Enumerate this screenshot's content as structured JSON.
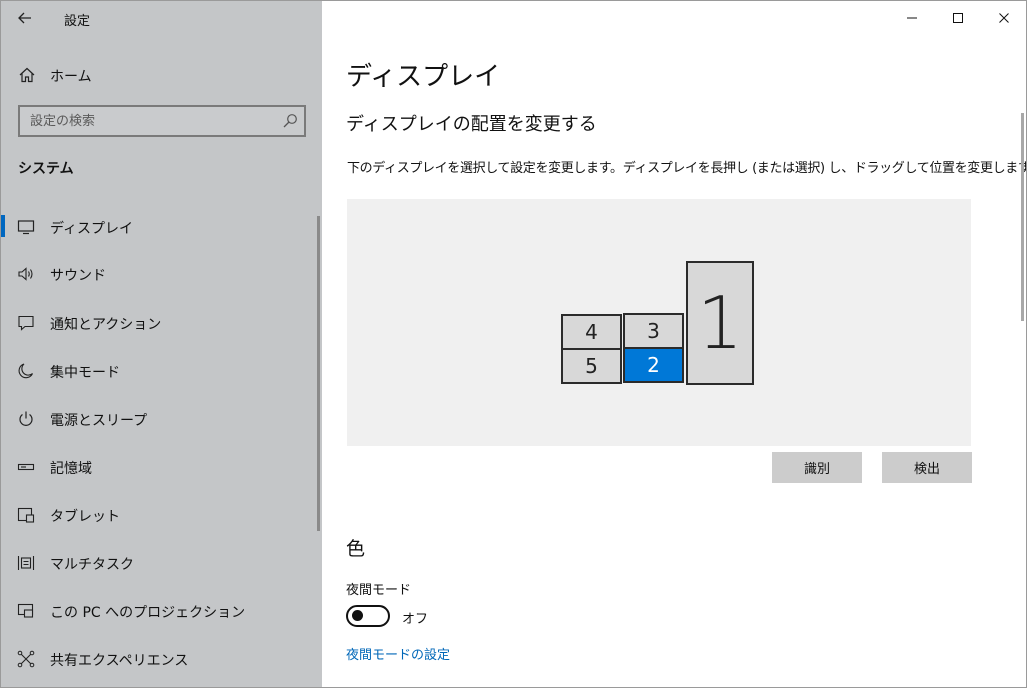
{
  "window": {
    "title": "設定",
    "buttons": {
      "minimize": "minimize",
      "maximize": "maximize",
      "close": "close"
    }
  },
  "sidebar": {
    "home_label": "ホーム",
    "search_placeholder": "設定の検索",
    "section_title": "システム",
    "items": [
      {
        "label": "ディスプレイ",
        "icon": "monitor-icon",
        "active": true
      },
      {
        "label": "サウンド",
        "icon": "speaker-icon",
        "active": false
      },
      {
        "label": "通知とアクション",
        "icon": "notification-icon",
        "active": false
      },
      {
        "label": "集中モード",
        "icon": "moon-icon",
        "active": false
      },
      {
        "label": "電源とスリープ",
        "icon": "power-icon",
        "active": false
      },
      {
        "label": "記憶域",
        "icon": "storage-icon",
        "active": false
      },
      {
        "label": "タブレット",
        "icon": "tablet-icon",
        "active": false
      },
      {
        "label": "マルチタスク",
        "icon": "multitask-icon",
        "active": false
      },
      {
        "label": "この PC へのプロジェクション",
        "icon": "projection-icon",
        "active": false
      },
      {
        "label": "共有エクスペリエンス",
        "icon": "shared-icon",
        "active": false
      }
    ]
  },
  "main": {
    "page_title": "ディスプレイ",
    "arrange_title": "ディスプレイの配置を変更する",
    "arrange_description": "下のディスプレイを選択して設定を変更します。ディスプレイを長押し (または選択) し、ドラッグして位置を変更します。",
    "monitors": [
      {
        "number": "1",
        "selected": false
      },
      {
        "number": "2",
        "selected": true
      },
      {
        "number": "3",
        "selected": false
      },
      {
        "number": "4",
        "selected": false
      },
      {
        "number": "5",
        "selected": false
      }
    ],
    "identify_label": "識別",
    "detect_label": "検出",
    "color_heading": "色",
    "night_light_label": "夜間モード",
    "night_light_toggle_state": "オフ",
    "night_light_link": "夜間モードの設定"
  },
  "colors": {
    "accent": "#0078d7",
    "link": "#0067b8",
    "sidebar_bg": "#c4c6c8",
    "arrange_bg": "#f0f0f0"
  }
}
